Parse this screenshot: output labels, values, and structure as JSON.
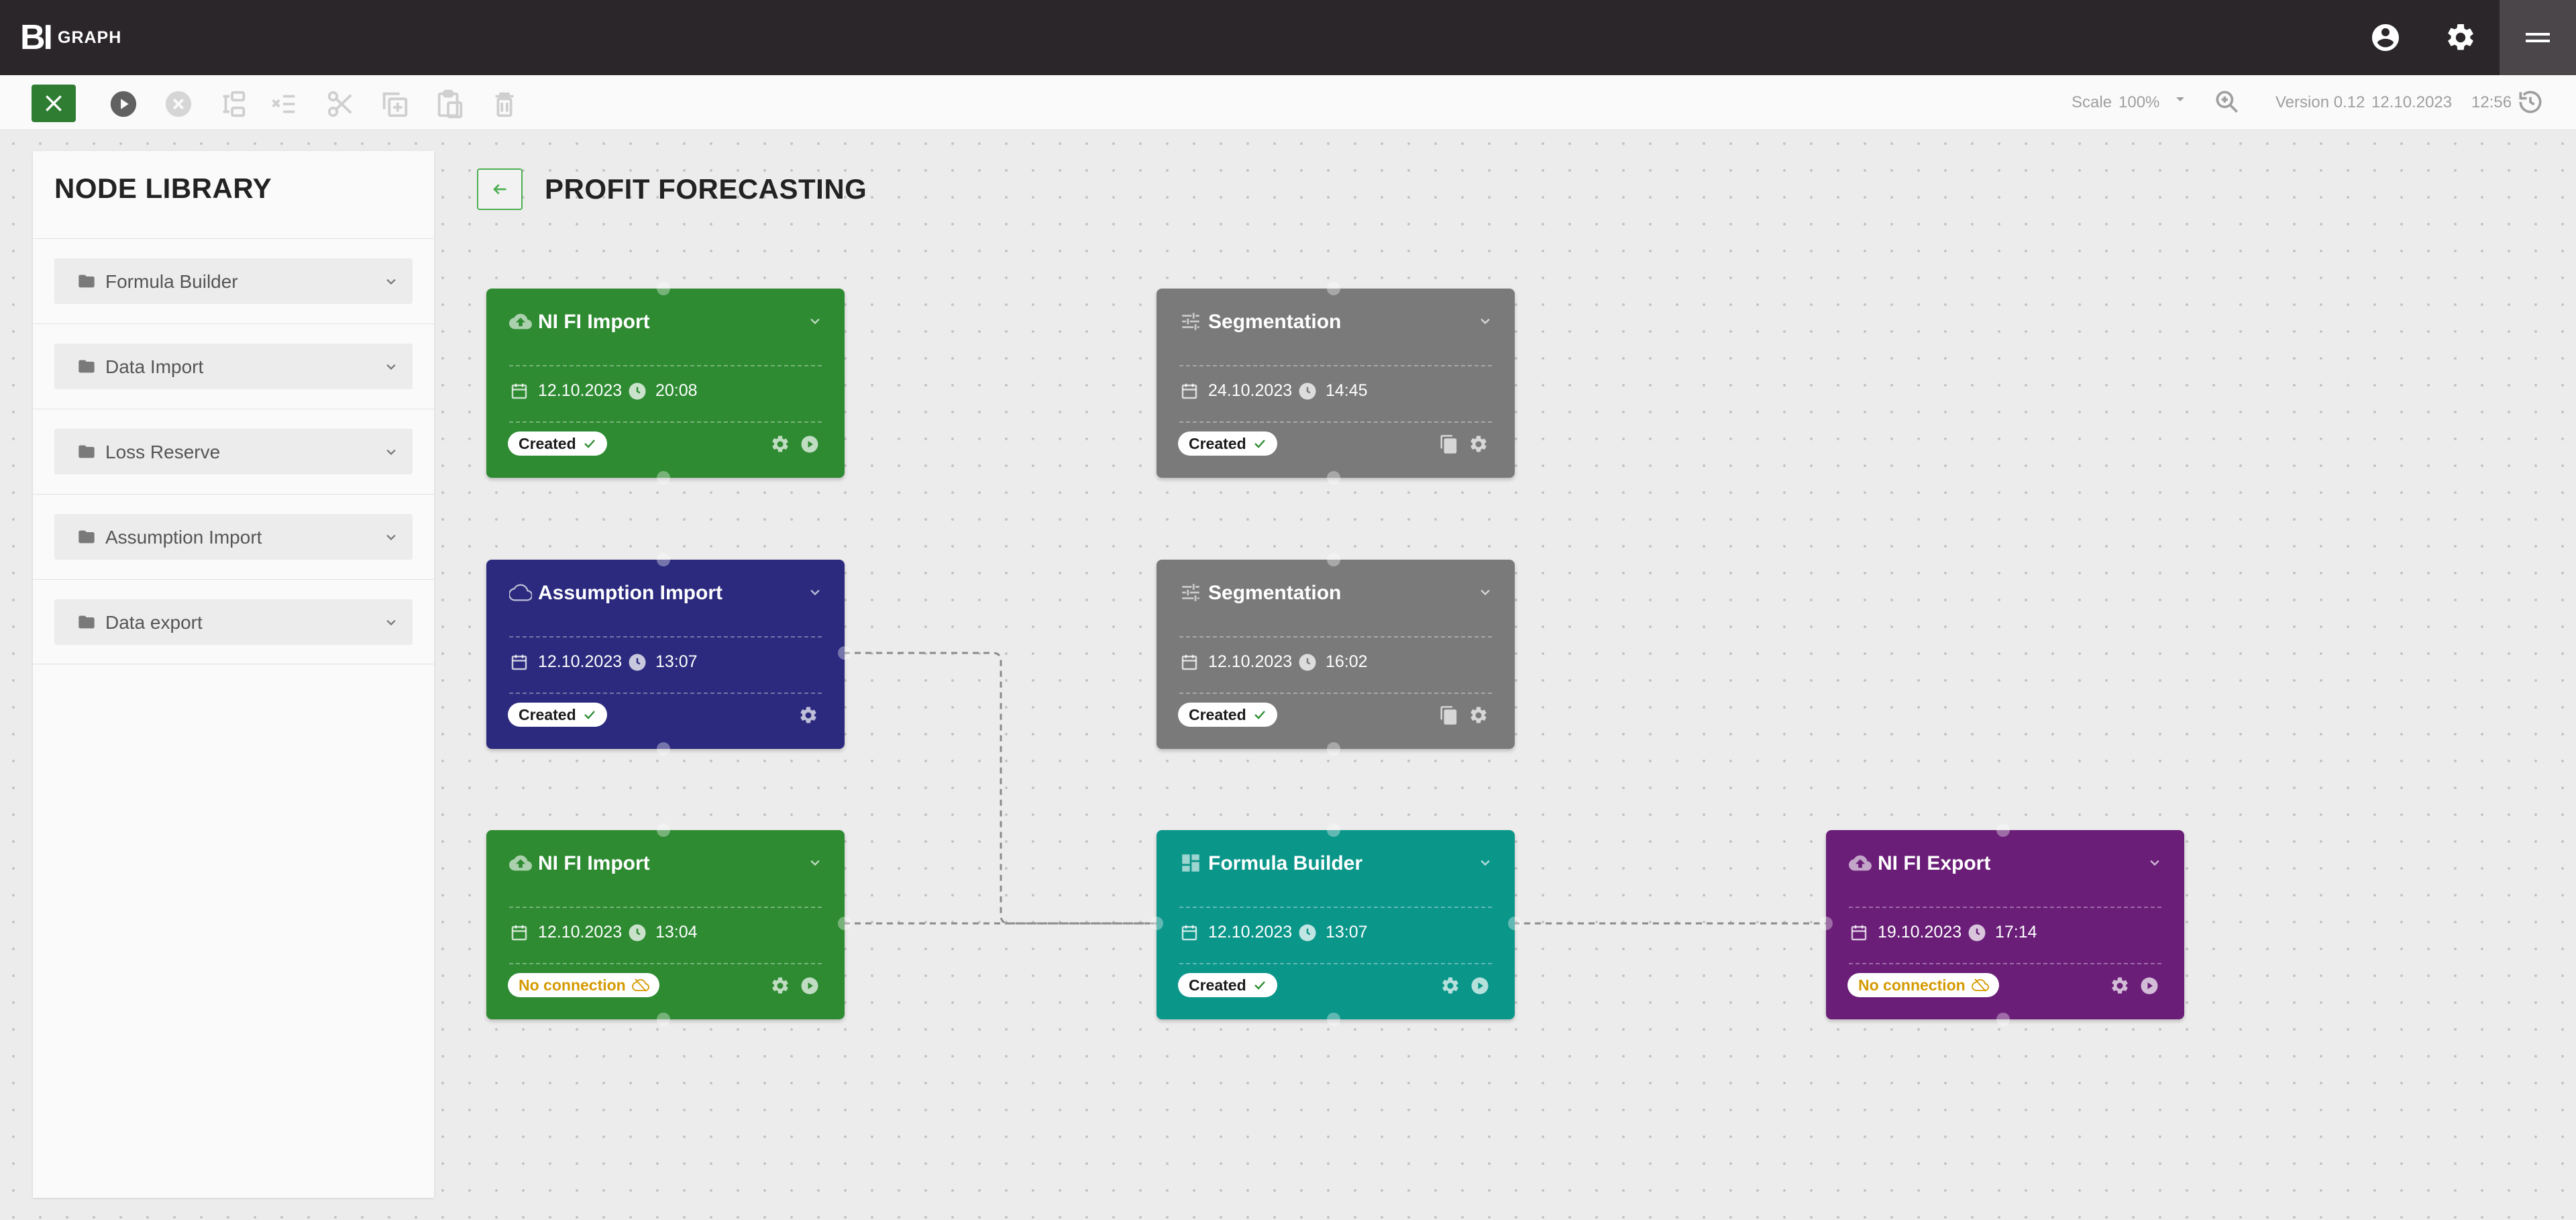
{
  "app": {
    "logo_mark": "BI",
    "logo_text": "GRAPH"
  },
  "header": {
    "icons": [
      "account-circle-icon",
      "settings-icon",
      "menu-icon"
    ]
  },
  "toolbar": {
    "icons": [
      "close-icon",
      "play-icon",
      "cancel-icon",
      "merge-icon",
      "remove-connection-icon",
      "cut-icon",
      "copy-icon",
      "paste-icon",
      "delete-icon",
      "dropdown-icon",
      "zoom-icon",
      "history-icon"
    ],
    "scale_label": "Scale",
    "scale_value": "100%",
    "version_label": "Version 0.12",
    "version_date": "12.10.2023",
    "version_time": "12:56"
  },
  "sidebar": {
    "title": "NODE LIBRARY",
    "groups": [
      {
        "label": "Formula Builder"
      },
      {
        "label": "Data Import"
      },
      {
        "label": "Loss Reserve"
      },
      {
        "label": "Assumption Import"
      },
      {
        "label": "Data export"
      }
    ]
  },
  "page": {
    "title": "PROFIT FORECASTING"
  },
  "nodes": [
    {
      "title": "NI FI Import",
      "date": "12.10.2023",
      "time": "20:08",
      "status": "Created",
      "color": "#2e8b32",
      "icon": "cloud-upload-icon"
    },
    {
      "title": "Segmentation",
      "date": "24.10.2023",
      "time": "14:45",
      "status": "Created",
      "color": "#7a7a7a",
      "icon": "tune-icon"
    },
    {
      "title": "Assumption Import",
      "date": "12.10.2023",
      "time": "13:07",
      "status": "Created",
      "color": "#2b2a7e",
      "icon": "cloud-outline-icon"
    },
    {
      "title": "Segmentation",
      "date": "12.10.2023",
      "time": "16:02",
      "status": "Created",
      "color": "#7a7a7a",
      "icon": "tune-icon"
    },
    {
      "title": "NI FI Import",
      "date": "12.10.2023",
      "time": "13:04",
      "status": "No connection",
      "color": "#2e8b32",
      "icon": "cloud-upload-icon"
    },
    {
      "title": "Formula Builder",
      "date": "12.10.2023",
      "time": "13:07",
      "status": "Created",
      "color": "#0b968a",
      "icon": "dashboard-icon"
    },
    {
      "title": "NI FI Export",
      "date": "19.10.2023",
      "time": "17:14",
      "status": "No connection",
      "color": "#6a1e78",
      "icon": "cloud-upload-icon"
    }
  ]
}
